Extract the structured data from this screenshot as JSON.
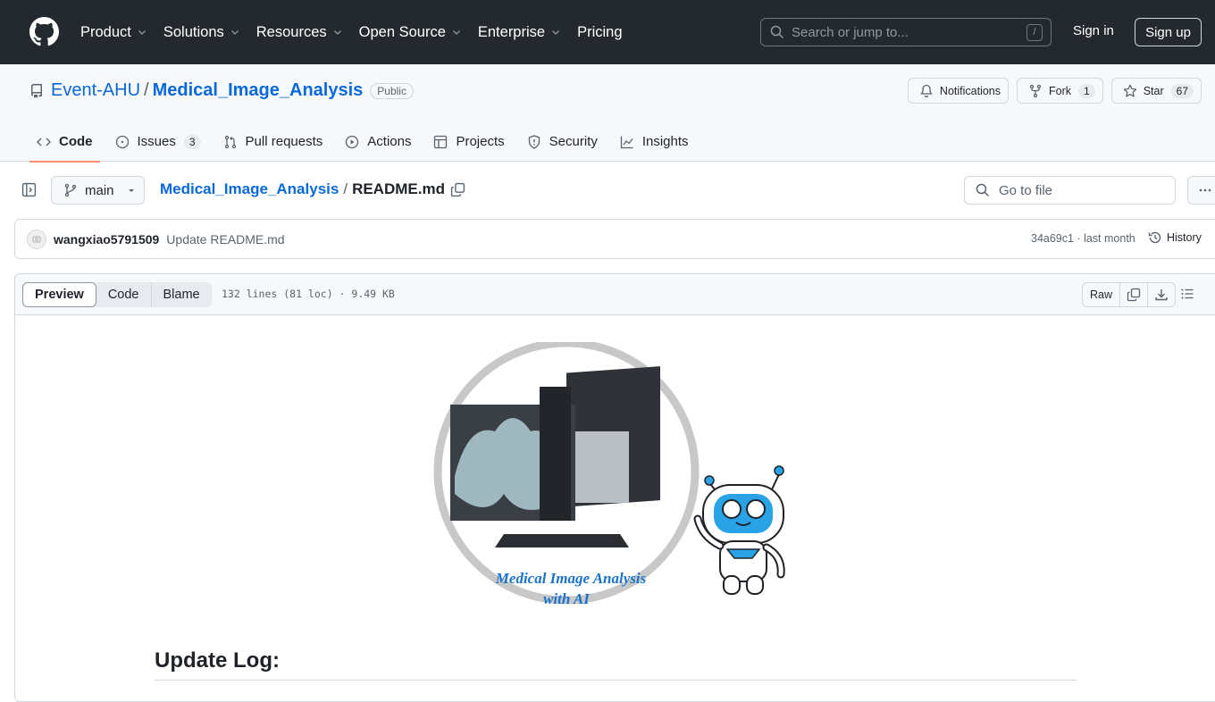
{
  "header": {
    "nav": [
      {
        "label": "Product",
        "has_dropdown": true
      },
      {
        "label": "Solutions",
        "has_dropdown": true
      },
      {
        "label": "Resources",
        "has_dropdown": true
      },
      {
        "label": "Open Source",
        "has_dropdown": true
      },
      {
        "label": "Enterprise",
        "has_dropdown": true
      },
      {
        "label": "Pricing",
        "has_dropdown": false
      }
    ],
    "search_placeholder": "Search or jump to...",
    "search_shortcut": "/",
    "sign_in": "Sign in",
    "sign_up": "Sign up"
  },
  "repo": {
    "owner": "Event-AHU",
    "separator": "/",
    "name": "Medical_Image_Analysis",
    "visibility": "Public",
    "actions": {
      "notifications": "Notifications",
      "fork": "Fork",
      "fork_count": "1",
      "star": "Star",
      "star_count": "67"
    },
    "tabs": [
      {
        "label": "Code",
        "icon": "code-icon",
        "active": true
      },
      {
        "label": "Issues",
        "icon": "issue-icon",
        "count": "3"
      },
      {
        "label": "Pull requests",
        "icon": "pull-request-icon"
      },
      {
        "label": "Actions",
        "icon": "play-icon"
      },
      {
        "label": "Projects",
        "icon": "table-icon"
      },
      {
        "label": "Security",
        "icon": "shield-icon"
      },
      {
        "label": "Insights",
        "icon": "graph-icon"
      }
    ]
  },
  "file": {
    "branch": "main",
    "breadcrumb_repo": "Medical_Image_Analysis",
    "breadcrumb_sep": "/",
    "filename": "README.md",
    "goto_placeholder": "Go to file",
    "commit": {
      "author": "wangxiao5791509",
      "message": "Update README.md",
      "sha": "34a69c1",
      "time": "last month",
      "history_label": "History"
    },
    "viewer": {
      "modes": [
        "Preview",
        "Code",
        "Blame"
      ],
      "active_mode": "Preview",
      "info": "132 lines (81 loc) · 9.49 KB",
      "raw_label": "Raw"
    }
  },
  "readme": {
    "banner_text_line1": "Medical Image Analysis",
    "banner_text_line2": "with AI",
    "heading": "Update Log:"
  },
  "colors": {
    "header_bg": "#24292f",
    "link": "#0969da",
    "active_tab_underline": "#fd8c73",
    "robot_blue": "#29a3e6"
  }
}
